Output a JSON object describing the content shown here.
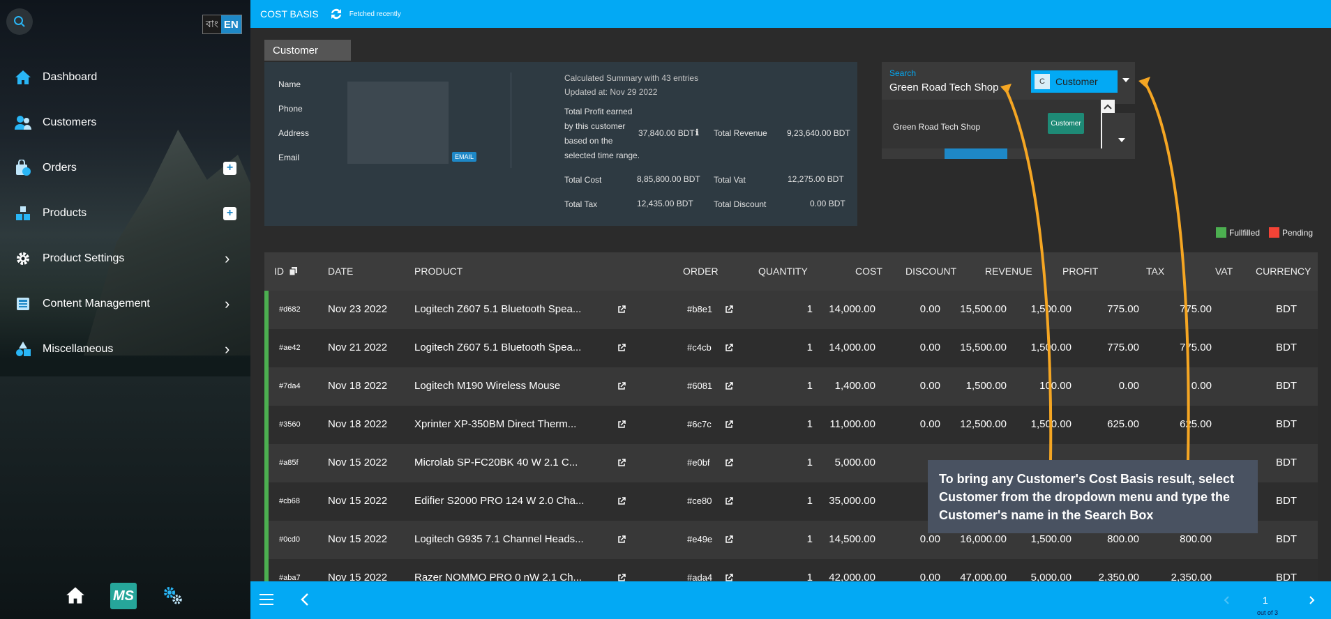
{
  "sidebar": {
    "lang": {
      "bn": "বাং",
      "en": "EN"
    },
    "items": [
      {
        "label": "Dashboard",
        "icon": "home-icon"
      },
      {
        "label": "Customers",
        "icon": "users-icon"
      },
      {
        "label": "Orders",
        "icon": "orders-icon"
      },
      {
        "label": "Products",
        "icon": "products-icon"
      },
      {
        "label": "Product Settings",
        "icon": "gear-icon"
      },
      {
        "label": "Content Management",
        "icon": "content-icon"
      },
      {
        "label": "Miscellaneous",
        "icon": "shapes-icon"
      }
    ],
    "bottom": {
      "logo_text": "MS"
    }
  },
  "topbar": {
    "title": "COST BASIS",
    "fetched": "Fetched recently"
  },
  "customer_panel": {
    "tab_label": "Customer",
    "fields": {
      "name": "Name",
      "phone": "Phone",
      "address": "Address",
      "email": "Email"
    },
    "email_badge": "EMAIL",
    "summary": {
      "title": "Calculated Summary with 43 entries",
      "updated": "Updated at: Nov 29 2022",
      "profit_label_1": "Total Profit earned",
      "profit_label_2": "by this customer",
      "profit_label_3": "based on the",
      "profit_label_4": "selected time range.",
      "profit_value": "37,840.00 BDT",
      "revenue_label": "Total Revenue",
      "revenue_value": "9,23,640.00 BDT",
      "cost_label": "Total Cost",
      "cost_value": "8,85,800.00 BDT",
      "vat_label": "Total Vat",
      "vat_value": "12,275.00 BDT",
      "tax_label": "Total Tax",
      "tax_value": "12,435.00 BDT",
      "discount_label": "Total Discount",
      "discount_value": "0.00 BDT"
    }
  },
  "search": {
    "label": "Search",
    "value": "Green Road Tech Shop",
    "type_letter": "C",
    "type_value": "Customer",
    "suggestion": {
      "name": "Green Road Tech Shop",
      "chip": "Customer"
    }
  },
  "legend": {
    "fulfilled": "Fullfilled",
    "pending": "Pending",
    "fulfilled_color": "#4caf50",
    "pending_color": "#f44336"
  },
  "table": {
    "headers": {
      "id": "ID",
      "date": "DATE",
      "product": "PRODUCT",
      "order": "ORDER",
      "quantity": "QUANTITY",
      "cost": "COST",
      "discount": "DISCOUNT",
      "revenue": "REVENUE",
      "profit": "PROFIT",
      "tax": "TAX",
      "vat": "VAT",
      "currency": "CURRENCY"
    },
    "rows": [
      {
        "id": "#d682",
        "date": "Nov 23 2022",
        "product": "Logitech Z607 5.1 Bluetooth Spea...",
        "order": "#b8e1",
        "quantity": "1",
        "cost": "14,000.00",
        "discount": "0.00",
        "revenue": "15,500.00",
        "profit": "1,500.00",
        "tax": "775.00",
        "vat": "775.00",
        "currency": "BDT"
      },
      {
        "id": "#ae42",
        "date": "Nov 21 2022",
        "product": "Logitech Z607 5.1 Bluetooth Spea...",
        "order": "#c4cb",
        "quantity": "1",
        "cost": "14,000.00",
        "discount": "0.00",
        "revenue": "15,500.00",
        "profit": "1,500.00",
        "tax": "775.00",
        "vat": "775.00",
        "currency": "BDT"
      },
      {
        "id": "#7da4",
        "date": "Nov 18 2022",
        "product": "Logitech M190 Wireless Mouse",
        "order": "#6081",
        "quantity": "1",
        "cost": "1,400.00",
        "discount": "0.00",
        "revenue": "1,500.00",
        "profit": "100.00",
        "tax": "0.00",
        "vat": "0.00",
        "currency": "BDT"
      },
      {
        "id": "#3560",
        "date": "Nov 18 2022",
        "product": "Xprinter XP-350BM Direct Therm...",
        "order": "#6c7c",
        "quantity": "1",
        "cost": "11,000.00",
        "discount": "0.00",
        "revenue": "12,500.00",
        "profit": "1,500.00",
        "tax": "625.00",
        "vat": "625.00",
        "currency": "BDT"
      },
      {
        "id": "#a85f",
        "date": "Nov 15 2022",
        "product": "Microlab SP-FC20BK 40 W 2.1 C...",
        "order": "#e0bf",
        "quantity": "1",
        "cost": "5,000.00",
        "discount": "",
        "revenue": "",
        "profit": "",
        "tax": "",
        "vat": "",
        "currency": "BDT"
      },
      {
        "id": "#cb68",
        "date": "Nov 15 2022",
        "product": "Edifier S2000 PRO 124 W 2.0 Cha...",
        "order": "#ce80",
        "quantity": "1",
        "cost": "35,000.00",
        "discount": "",
        "revenue": "",
        "profit": "",
        "tax": "",
        "vat": "",
        "currency": "BDT"
      },
      {
        "id": "#0cd0",
        "date": "Nov 15 2022",
        "product": "Logitech G935 7.1 Channel Heads...",
        "order": "#e49e",
        "quantity": "1",
        "cost": "14,500.00",
        "discount": "0.00",
        "revenue": "16,000.00",
        "profit": "1,500.00",
        "tax": "800.00",
        "vat": "800.00",
        "currency": "BDT"
      },
      {
        "id": "#aba7",
        "date": "Nov 15 2022",
        "product": "Razer NOMMO PRO 0 nW 2.1 Ch...",
        "order": "#ada4",
        "quantity": "1",
        "cost": "42,000.00",
        "discount": "0.00",
        "revenue": "47,000.00",
        "profit": "5,000.00",
        "tax": "2,350.00",
        "vat": "2,350.00",
        "currency": "BDT"
      }
    ]
  },
  "pagination": {
    "page": "1",
    "of": "out of 3"
  },
  "callout": {
    "text": "To bring any Customer's Cost Basis result, select Customer from the dropdown menu and type the Customer's name in the Search Box"
  },
  "colors": {
    "accent": "#03a9f4",
    "fulfilled_bar": "#4caf50",
    "arrow": "#f5a623"
  }
}
